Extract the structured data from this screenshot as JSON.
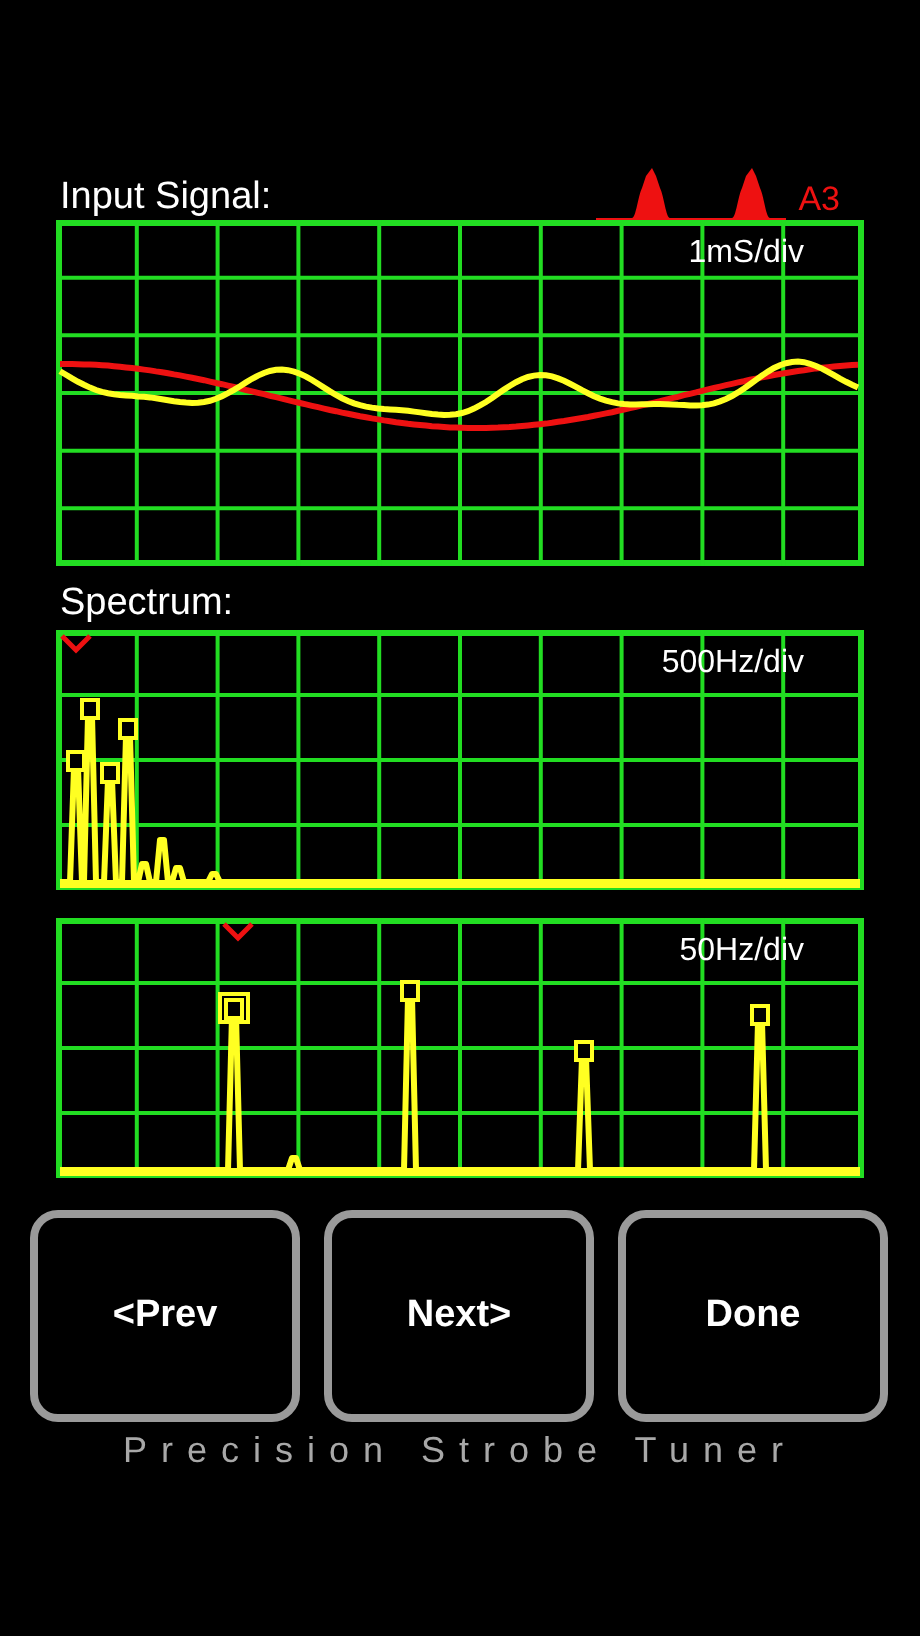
{
  "input_signal": {
    "label": "Input Signal:",
    "note": "A3",
    "scale": "1mS/div"
  },
  "spectrum": {
    "label": "Spectrum:",
    "panels": [
      {
        "scale": "500Hz/div"
      },
      {
        "scale": "50Hz/div"
      }
    ]
  },
  "buttons": [
    "<Prev",
    "Next>",
    "Done"
  ],
  "footer": "Precision Strobe Tuner"
}
